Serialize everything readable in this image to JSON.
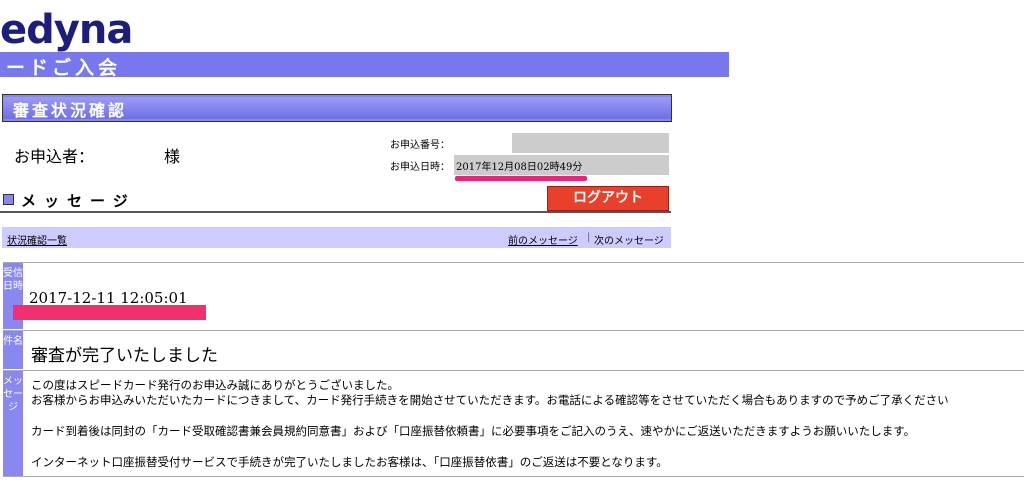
{
  "brand": {
    "logo_text": "edyna",
    "banner_text": "ードご入会"
  },
  "section_title": "審査状況確認",
  "applicant": {
    "label": "お申込者：",
    "honorific": "様"
  },
  "application": {
    "number_label": "お申込番号：",
    "date_label": "お申込日時：",
    "date_value": "2017年12月08日02時49分"
  },
  "messages": {
    "heading": "メッセージ",
    "logout_label": "ログアウト"
  },
  "nav": {
    "status_list": "状況確認一覧",
    "prev_message": "前のメッセージ",
    "separator": "|",
    "next_message": "次のメッセージ"
  },
  "detail": {
    "received_label": "受信日時",
    "received_value": "2017-12-11 12:05:01",
    "subject_label": "件名",
    "subject_value": "審査が完了いたしました",
    "message_label": "メッセージ",
    "message_lines": [
      "この度はスピードカード発行のお申込み誠にありがとうございました。",
      "お客様からお申込みいただいたカードにつきまして、カード発行手続きを開始させていただきます。お電話による確認等をさせていただく場合もありますので予めご了承ください",
      "カード到着後は同封の「カード受取確認書兼会員規約同意書」および「口座振替依頼書」に必要事項をご記入のうえ、速やかにご返送いただきますようお願いいたします。",
      "インターネット口座振替受付サービスで手続きが完了いたしましたお客様は、「口座振替依書」のご返送は不要となります。"
    ]
  },
  "colors": {
    "accent": "#7777ee",
    "logout": "#e8402a",
    "redaction": "#f0306f",
    "nav_bg": "#ccccff"
  }
}
